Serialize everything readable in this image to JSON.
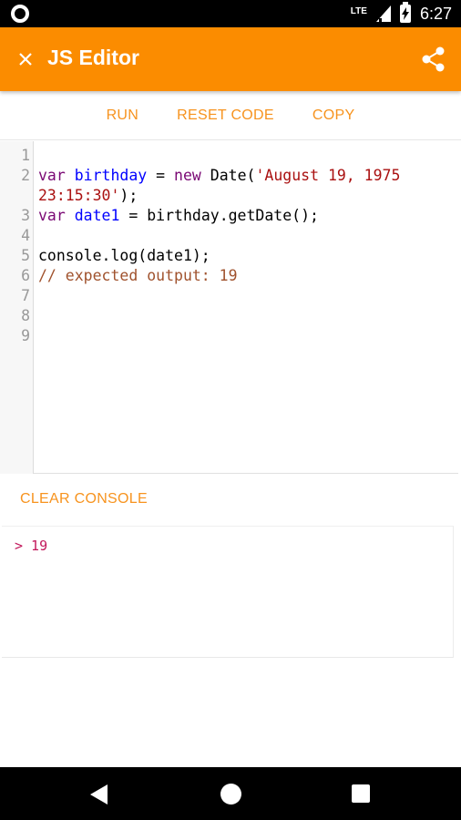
{
  "status_bar": {
    "network": "LTE",
    "time": "6:27"
  },
  "app_bar": {
    "title": "JS Editor",
    "close_icon": "close-icon",
    "share_icon": "share-icon",
    "color": "#fb8c00"
  },
  "toolbar": {
    "run_label": "RUN",
    "reset_label": "RESET CODE",
    "copy_label": "COPY",
    "accent": "#f7931e"
  },
  "editor": {
    "line_numbers": [
      "1",
      "2",
      "",
      "3",
      "4",
      "5",
      "6",
      "7",
      "8",
      "9"
    ],
    "lines": {
      "l2a_kw": "var",
      "l2a_var": "birthday",
      "l2a_mid": " = ",
      "l2a_new": "new",
      "l2a_fn": " Date(",
      "l2a_str": "'August 19, 1975",
      "l2b_str": "23:15:30'",
      "l2b_end": ");",
      "l3_kw": "var",
      "l3_var": "date1",
      "l3_rest": " = birthday.getDate();",
      "l5": "console.log(date1);",
      "l6": "// expected output: 19"
    }
  },
  "console": {
    "clear_label": "CLEAR CONSOLE",
    "output": "> 19"
  }
}
